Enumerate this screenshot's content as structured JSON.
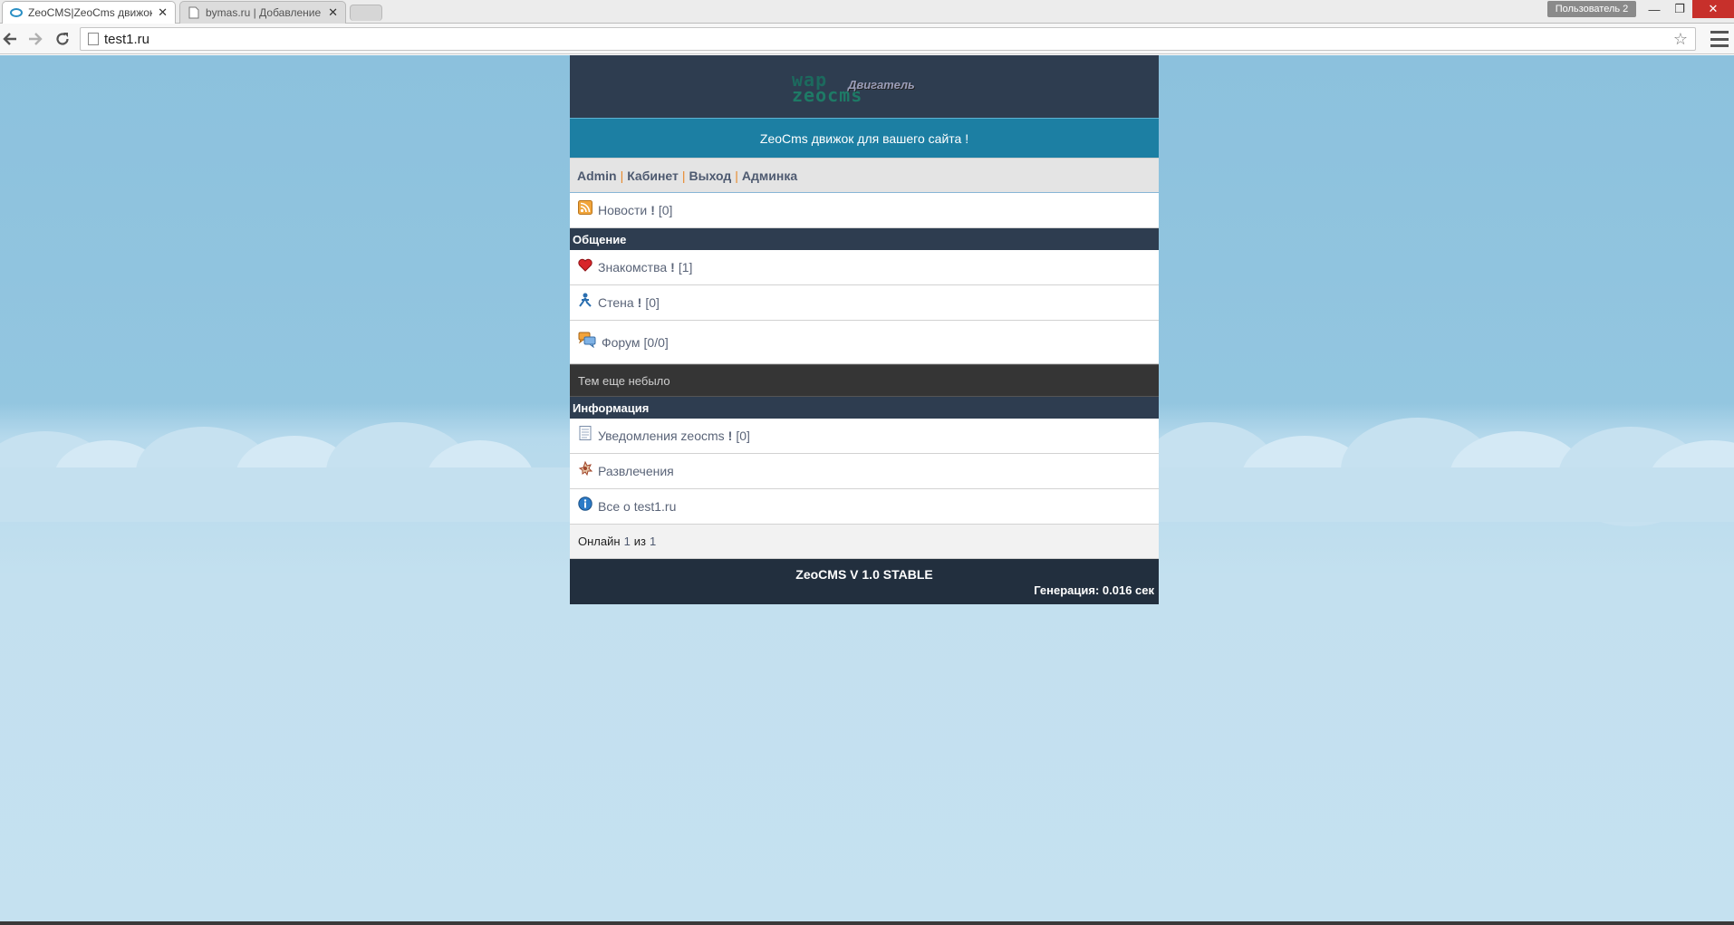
{
  "browser": {
    "tabs": [
      {
        "label": "ZeoCMS|ZeoCms движок",
        "active": true
      },
      {
        "label": "bymas.ru | Добавление ф",
        "active": false
      }
    ],
    "profile": "Пользователь 2",
    "url": "test1.ru"
  },
  "site": {
    "logo": {
      "line1": "wap",
      "line2": "zeocms",
      "line3": "Двигатель"
    },
    "slogan": "ZeoCms движок для вашего сайта !",
    "usernav": [
      {
        "label": "Admin"
      },
      {
        "label": "Кабинет"
      },
      {
        "label": "Выход"
      },
      {
        "label": "Админка"
      }
    ],
    "separator": "|",
    "news": {
      "label": "Новости",
      "mark": "!",
      "count": "[0]",
      "icon": "rss-icon"
    },
    "sections": {
      "social": "Общение",
      "info": "Информация"
    },
    "social_items": [
      {
        "label": "Знакомства",
        "mark": "!",
        "count": "[1]",
        "icon": "heart-icon"
      },
      {
        "label": "Стена",
        "mark": "!",
        "count": "[0]",
        "icon": "person-icon"
      },
      {
        "label": "Форум",
        "count": "[0/0]",
        "icon": "chat-icon"
      }
    ],
    "forum_empty": "Тем еще небыло",
    "info_items": [
      {
        "label": "Уведомления zeocms",
        "mark": "!",
        "count": "[0]",
        "icon": "notebook-icon"
      },
      {
        "label": "Развлечения",
        "icon": "fun-icon"
      },
      {
        "label": "Все о test1.ru",
        "icon": "info-icon"
      }
    ],
    "online": {
      "prefix": "Онлайн",
      "current": "1",
      "middle": "из",
      "total": "1"
    },
    "footer": {
      "version": "ZeoCMS V 1.0 STABLE",
      "generation": "Генерация: 0.016 сек"
    }
  },
  "colors": {
    "header_bg": "#2e3d50",
    "slogan_bg": "#1c7fa3",
    "link": "#4e5a70",
    "separator": "#e8892b",
    "sky": "#8cc1dd"
  }
}
